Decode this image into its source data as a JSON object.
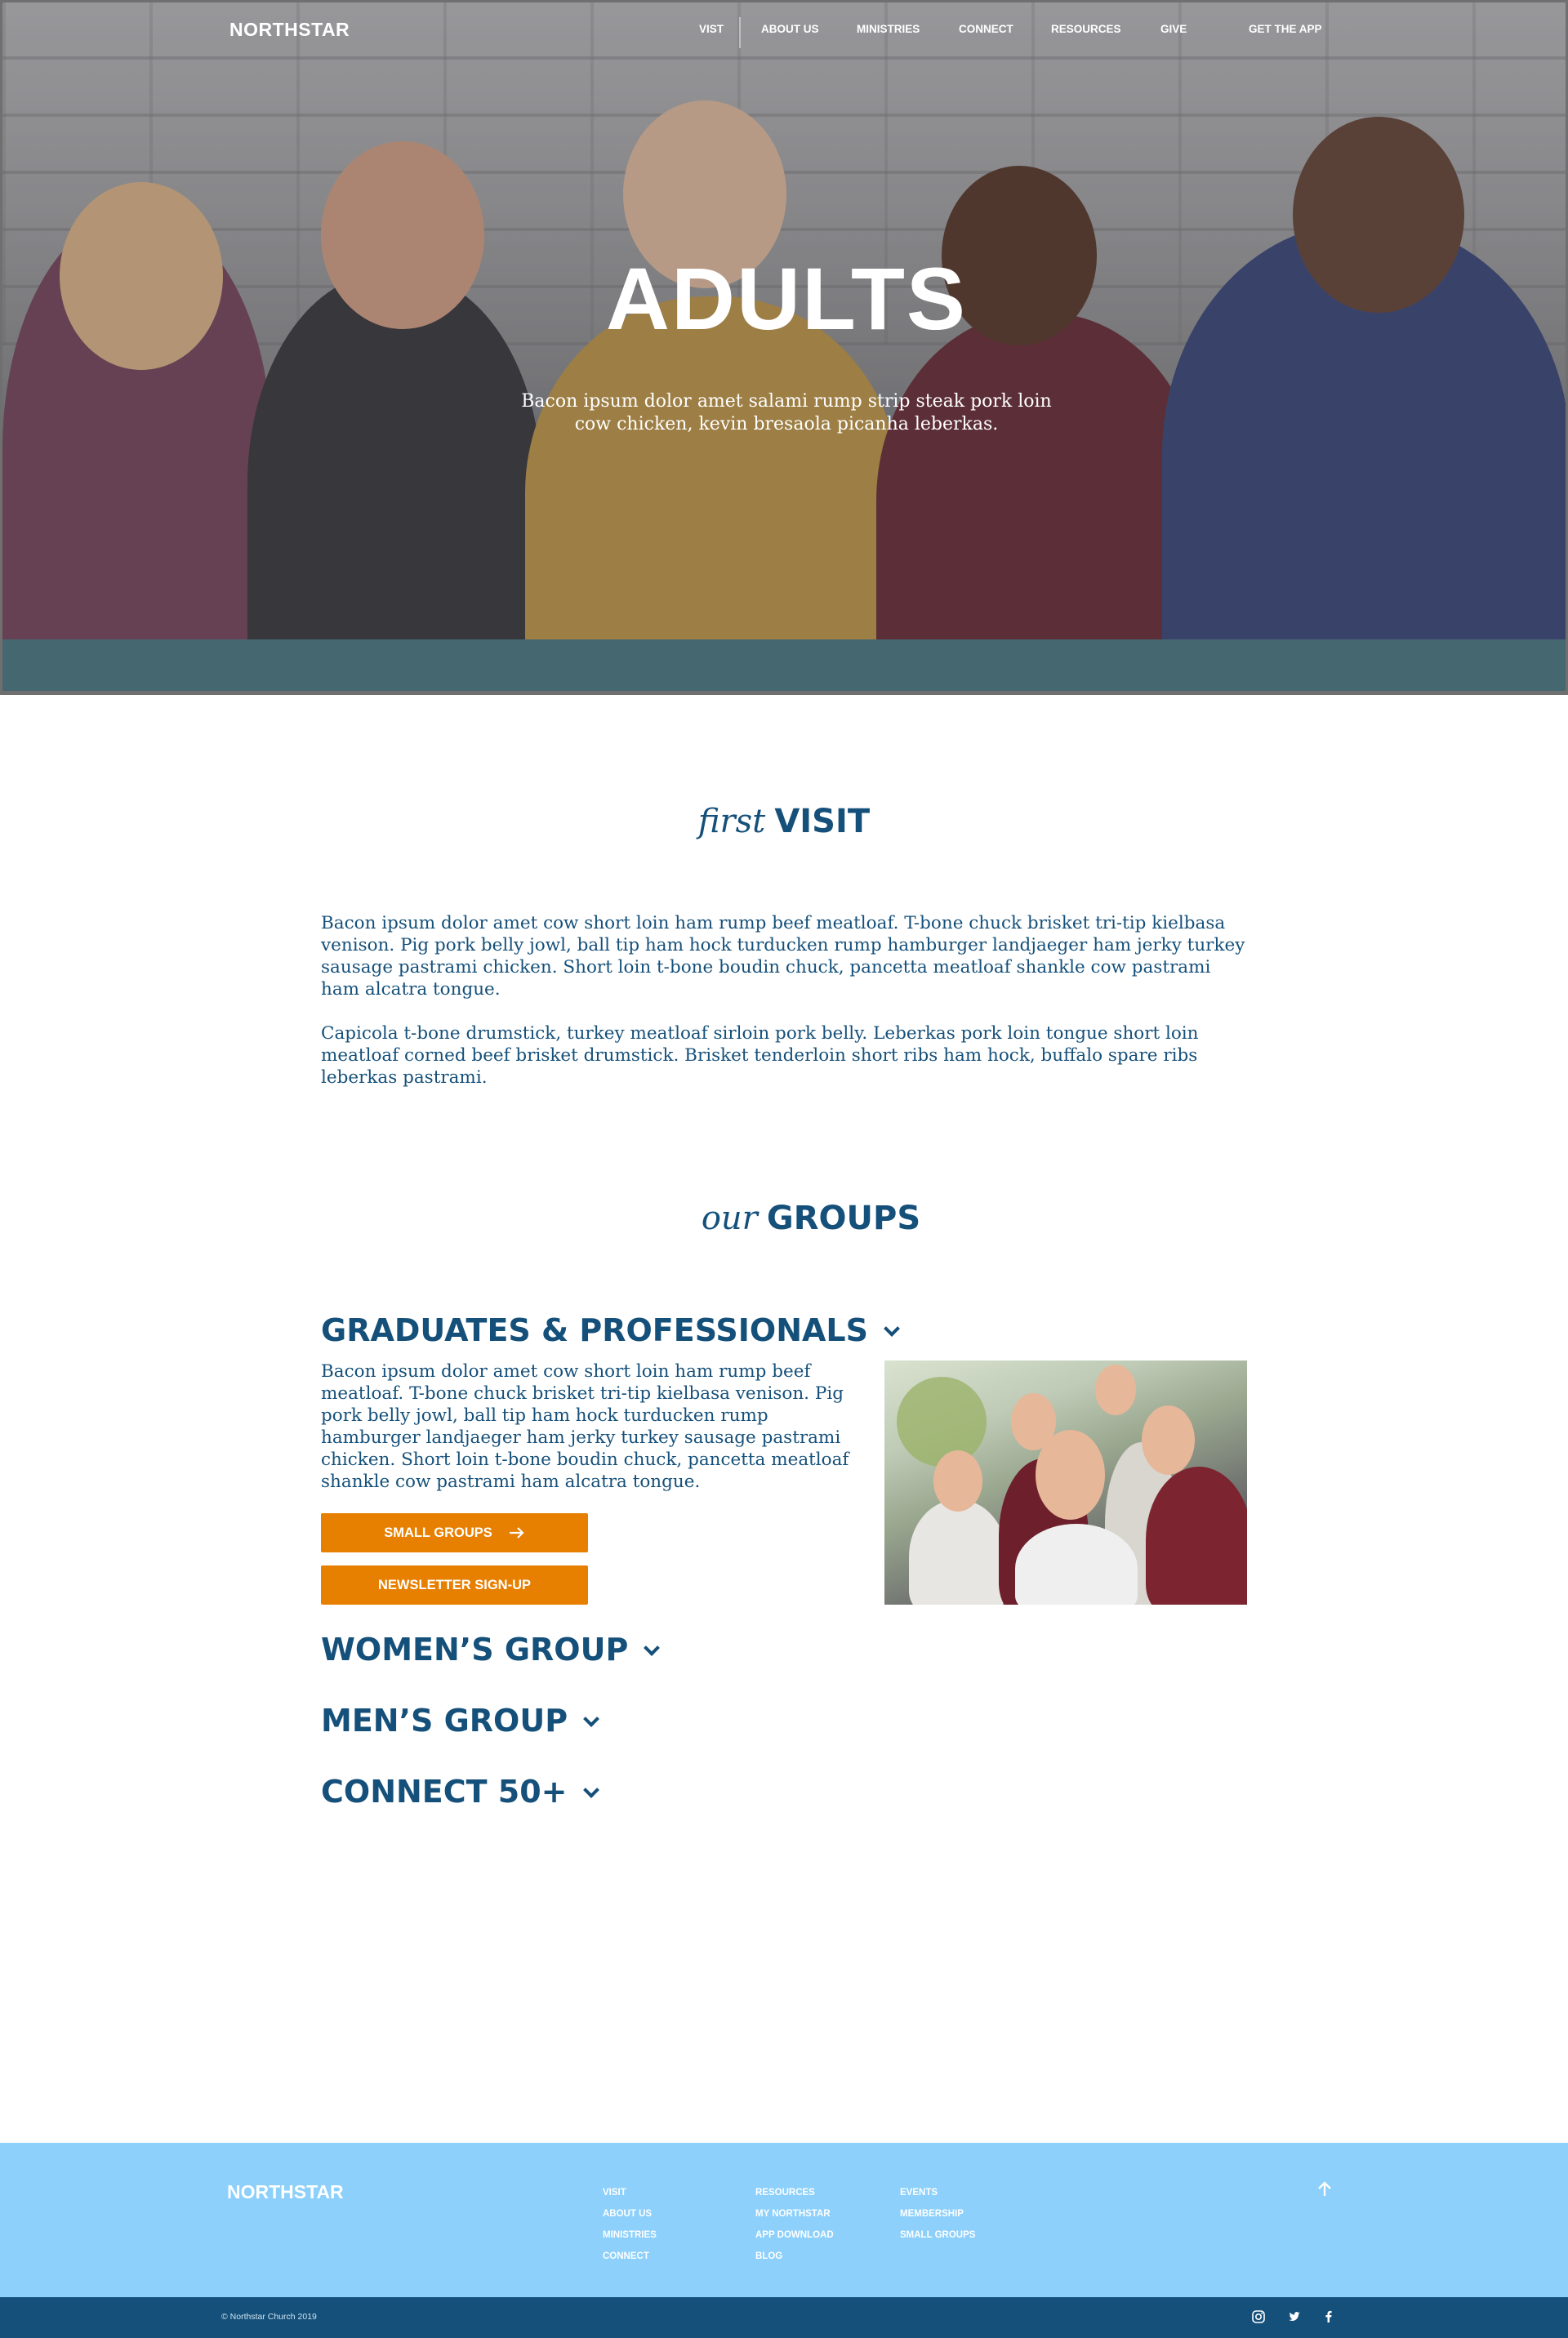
{
  "nav": {
    "logo": "NORTHSTAR",
    "items": [
      "VIST",
      "ABOUT US",
      "MINISTRIES",
      "CONNECT",
      "RESOURCES",
      "GIVE"
    ],
    "cta": "GET THE APP"
  },
  "hero": {
    "title": "ADULTS",
    "subtitle": "Bacon ipsum dolor amet salami rump strip steak pork loin cow chicken, kevin bresaola picanha leberkas."
  },
  "first_visit": {
    "heading_italic": "first",
    "heading_bold": "VISIT",
    "paragraphs": [
      "Bacon ipsum dolor amet cow short loin ham rump beef meatloaf. T-bone chuck brisket tri-tip kielbasa venison. Pig pork belly jowl, ball tip ham hock turducken rump hamburger landjaeger ham jerky turkey sausage pastrami chicken. Short loin t-bone boudin chuck, pancetta meatloaf shankle cow pastrami ham alcatra tongue.",
      "Capicola t-bone drumstick, turkey meatloaf sirloin pork belly. Leberkas pork loin tongue short loin meatloaf corned beef brisket drumstick. Brisket tenderloin short ribs ham hock, buffalo spare ribs leberkas pastrami."
    ]
  },
  "groups": {
    "heading_italic": "our",
    "heading_bold": "GROUPS",
    "items": [
      {
        "title": "GRADUATES & PROFESSIONALS",
        "expanded": true,
        "text": "Bacon ipsum dolor amet cow short loin ham rump beef meatloaf. T-bone chuck brisket tri-tip kielbasa venison. Pig pork belly jowl, ball tip ham hock turducken rump hamburger landjaeger ham jerky turkey sausage pastrami chicken. Short loin t-bone boudin chuck, pancetta meatloaf shankle cow pastrami ham alcatra tongue.",
        "buttons": [
          "SMALL GROUPS",
          "NEWSLETTER SIGN-UP"
        ]
      },
      {
        "title": "WOMEN’S GROUP",
        "expanded": false
      },
      {
        "title": "MEN’S GROUP",
        "expanded": false
      },
      {
        "title": "CONNECT 50+",
        "expanded": false
      }
    ]
  },
  "footer": {
    "logo": "NORTHSTAR",
    "col1": [
      "VISIT",
      "ABOUT US",
      "MINISTRIES",
      "CONNECT"
    ],
    "col2": [
      "RESOURCES",
      "MY NORTHSTAR",
      "APP DOWNLOAD",
      "BLOG"
    ],
    "col3": [
      "EVENTS",
      "MEMBERSHIP",
      "SMALL GROUPS"
    ],
    "copyright": "© Northstar Church 2019",
    "social_icons": [
      "instagram-icon",
      "twitter-icon",
      "facebook-icon"
    ]
  },
  "colors": {
    "primary_blue": "#15507a",
    "accent_orange": "#e77f00",
    "footer_light_blue": "#8dd0fb"
  }
}
